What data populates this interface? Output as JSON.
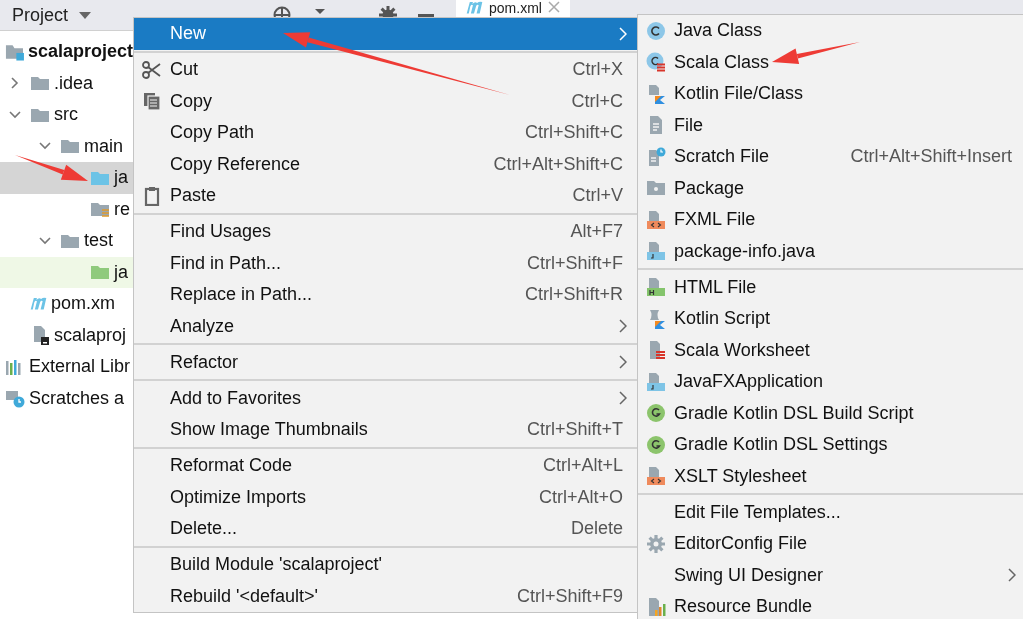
{
  "toolbar": {
    "title": "Project",
    "tab": {
      "label": "pom.xml",
      "selected": true
    }
  },
  "tree": [
    {
      "label": "scalaproject",
      "kind": "project",
      "bold": true,
      "children": [
        {
          "label": ".idea",
          "kind": "folder",
          "expanded": false
        },
        {
          "label": "src",
          "kind": "folder",
          "expanded": true,
          "children": [
            {
              "label": "main",
              "kind": "folder",
              "expanded": true,
              "children": [
                {
                  "label": "ja",
                  "kind": "source-folder",
                  "selected": true
                },
                {
                  "label": "re",
                  "kind": "resource-folder",
                  "selected": false
                }
              ]
            },
            {
              "label": "test",
              "kind": "folder",
              "expanded": true,
              "children": [
                {
                  "label": "ja",
                  "kind": "test-folder",
                  "selected": false,
                  "highlighted": true
                }
              ]
            }
          ]
        },
        {
          "label": "pom.xm",
          "kind": "maven"
        },
        {
          "label": "scalaproj",
          "kind": "module-file"
        }
      ]
    },
    {
      "label": "External Libr",
      "kind": "libraries"
    },
    {
      "label": "Scratches a",
      "kind": "scratches"
    }
  ],
  "context_menu": {
    "sections": [
      [
        {
          "label": "New",
          "submenu": true,
          "selected": true
        }
      ],
      [
        {
          "label": "Cut",
          "shortcut": "Ctrl+X",
          "kind": "scissors",
          "selected": false
        },
        {
          "label": "Copy",
          "shortcut": "Ctrl+C",
          "kind": "copy",
          "selected": false
        },
        {
          "label": "Copy Path",
          "shortcut": "Ctrl+Shift+C",
          "selected": false
        },
        {
          "label": "Copy Reference",
          "shortcut": "Ctrl+Alt+Shift+C",
          "selected": false
        },
        {
          "label": "Paste",
          "shortcut": "Ctrl+V",
          "kind": "clipboard",
          "selected": false
        }
      ],
      [
        {
          "label": "Find Usages",
          "shortcut": "Alt+F7",
          "selected": false
        },
        {
          "label": "Find in Path...",
          "shortcut": "Ctrl+Shift+F",
          "selected": false
        },
        {
          "label": "Replace in Path...",
          "shortcut": "Ctrl+Shift+R",
          "selected": false
        },
        {
          "label": "Analyze",
          "submenu": true,
          "selected": false
        }
      ],
      [
        {
          "label": "Refactor",
          "submenu": true,
          "selected": false
        }
      ],
      [
        {
          "label": "Add to Favorites",
          "submenu": true,
          "selected": false
        },
        {
          "label": "Show Image Thumbnails",
          "shortcut": "Ctrl+Shift+T",
          "selected": false
        }
      ],
      [
        {
          "label": "Reformat Code",
          "shortcut": "Ctrl+Alt+L",
          "selected": false
        },
        {
          "label": "Optimize Imports",
          "shortcut": "Ctrl+Alt+O",
          "selected": false
        },
        {
          "label": "Delete...",
          "shortcut": "Delete",
          "selected": false
        }
      ],
      [
        {
          "label": "Build Module 'scalaproject'",
          "selected": false
        },
        {
          "label": "Rebuild '<default>'",
          "shortcut": "Ctrl+Shift+F9",
          "selected": false
        }
      ]
    ]
  },
  "new_submenu": {
    "sections": [
      [
        {
          "label": "Java Class",
          "kind": "java-class"
        },
        {
          "label": "Scala Class",
          "kind": "scala-class"
        },
        {
          "label": "Kotlin File/Class",
          "kind": "kotlin-file"
        },
        {
          "label": "File",
          "kind": "file"
        },
        {
          "label": "Scratch File",
          "kind": "scratch-file",
          "shortcut": "Ctrl+Alt+Shift+Insert"
        },
        {
          "label": "Package",
          "kind": "package"
        },
        {
          "label": "FXML File",
          "kind": "fxml-file"
        },
        {
          "label": "package-info.java",
          "kind": "java-file"
        }
      ],
      [
        {
          "label": "HTML File",
          "kind": "html-file"
        },
        {
          "label": "Kotlin Script",
          "kind": "kotlin-script"
        },
        {
          "label": "Scala Worksheet",
          "kind": "scala-worksheet"
        },
        {
          "label": "JavaFXApplication",
          "kind": "java-file"
        },
        {
          "label": "Gradle Kotlin DSL Build Script",
          "kind": "gradle"
        },
        {
          "label": "Gradle Kotlin DSL Settings",
          "kind": "gradle"
        },
        {
          "label": "XSLT Stylesheet",
          "kind": "fxml-file"
        }
      ],
      [
        {
          "label": "Edit File Templates..."
        },
        {
          "label": "EditorConfig File",
          "kind": "gear"
        },
        {
          "label": "Swing UI Designer",
          "submenu": true
        },
        {
          "label": "Resource Bundle",
          "kind": "resource-bundle"
        }
      ]
    ]
  }
}
